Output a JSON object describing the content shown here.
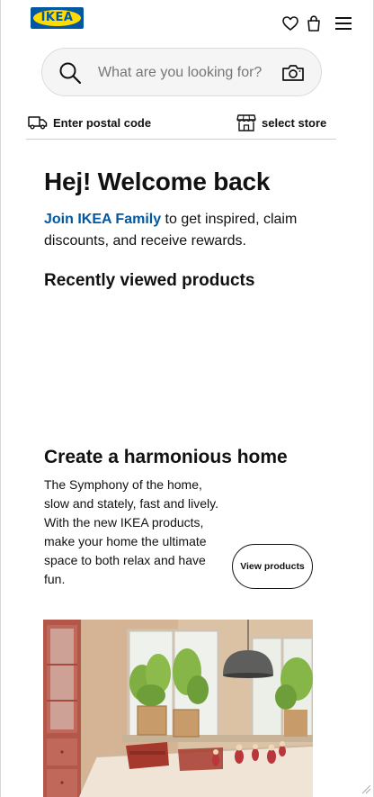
{
  "header": {
    "logo_text": "IKEA",
    "icons": [
      "heart-icon",
      "shopping-bag-icon",
      "hamburger-menu-icon"
    ]
  },
  "search": {
    "placeholder": "What are you looking for?",
    "value": ""
  },
  "delivery": {
    "postal_label": "Enter postal code",
    "store_label": "select store"
  },
  "welcome": {
    "title": "Hej! Welcome back",
    "link_text": "Join IKEA Family",
    "link_rest": " to get inspired, claim discounts, and receive rewards."
  },
  "recently_viewed": {
    "title": "Recently viewed products"
  },
  "campaign": {
    "title": "Create a harmonious home",
    "body": "The Symphony of the home, slow and stately, fast and lively. With the new IKEA products, make your home the ultimate space to both relax and have fun.",
    "button_label": "View products"
  },
  "colors": {
    "ikea_blue": "#0058a3",
    "ikea_yellow": "#ffdb00",
    "text": "#111111"
  }
}
